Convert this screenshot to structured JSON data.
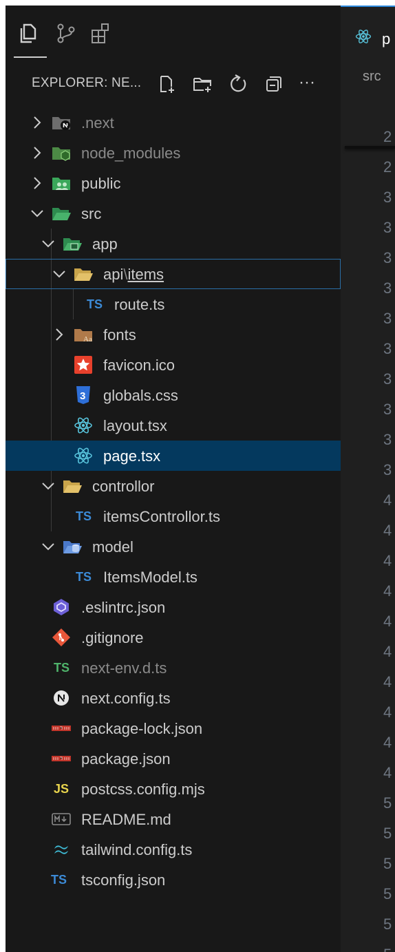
{
  "activity_bar": {
    "items": [
      {
        "icon": "explorer-files-icon",
        "active": true
      },
      {
        "icon": "source-control-icon",
        "active": false
      },
      {
        "icon": "extensions-icon",
        "active": false
      }
    ]
  },
  "explorer": {
    "title": "EXPLORER: NE...",
    "actions": [
      "new-file-icon",
      "new-folder-icon",
      "refresh-icon",
      "collapse-all-icon",
      "more-actions-icon"
    ],
    "more_label": "···"
  },
  "tree": [
    {
      "name": ".next",
      "type": "folder",
      "expanded": false,
      "dim": true
    },
    {
      "name": "node_modules",
      "type": "folder",
      "expanded": false,
      "dim": true
    },
    {
      "name": "public",
      "type": "folder",
      "expanded": false
    },
    {
      "name": "src",
      "type": "folder",
      "expanded": true
    },
    {
      "name": "app",
      "type": "folder",
      "expanded": true
    },
    {
      "name": "api",
      "sep": "\\",
      "name2": "items",
      "type": "folder",
      "expanded": true,
      "focused": true
    },
    {
      "name": "route.ts",
      "type": "file",
      "icon_text": "TS"
    },
    {
      "name": "fonts",
      "type": "folder",
      "expanded": false
    },
    {
      "name": "favicon.ico",
      "type": "file"
    },
    {
      "name": "globals.css",
      "type": "file"
    },
    {
      "name": "layout.tsx",
      "type": "file"
    },
    {
      "name": "page.tsx",
      "type": "file",
      "selected": true
    },
    {
      "name": "controllor",
      "type": "folder",
      "expanded": true
    },
    {
      "name": "itemsControllor.ts",
      "type": "file",
      "icon_text": "TS"
    },
    {
      "name": "model",
      "type": "folder",
      "expanded": true
    },
    {
      "name": "ItemsModel.ts",
      "type": "file",
      "icon_text": "TS"
    },
    {
      "name": ".eslintrc.json",
      "type": "file"
    },
    {
      "name": ".gitignore",
      "type": "file"
    },
    {
      "name": "next-env.d.ts",
      "type": "file",
      "icon_text": "TS",
      "dim": true
    },
    {
      "name": "next.config.ts",
      "type": "file"
    },
    {
      "name": "package-lock.json",
      "type": "file"
    },
    {
      "name": "package.json",
      "type": "file"
    },
    {
      "name": "postcss.config.mjs",
      "type": "file",
      "icon_text": "JS"
    },
    {
      "name": "README.md",
      "type": "file"
    },
    {
      "name": "tailwind.config.ts",
      "type": "file"
    },
    {
      "name": "tsconfig.json",
      "type": "file",
      "icon_text": "TS"
    }
  ],
  "editor": {
    "tab_label": "p",
    "breadcrumb": "src",
    "line_numbers": [
      "2",
      "2",
      "3",
      "3",
      "3",
      "3",
      "3",
      "3",
      "3",
      "3",
      "3",
      "3",
      "4",
      "4",
      "4",
      "4",
      "4",
      "4",
      "4",
      "4",
      "4",
      "4",
      "5",
      "5",
      "5",
      "5",
      "5",
      "5"
    ]
  },
  "colors": {
    "selection": "#04395e",
    "focus": "#2a6fa8",
    "ts_blue": "#3c8ad6",
    "ts_green": "#4fb36b",
    "js_yellow": "#e8d44d",
    "react_blue": "#58c4dc"
  }
}
